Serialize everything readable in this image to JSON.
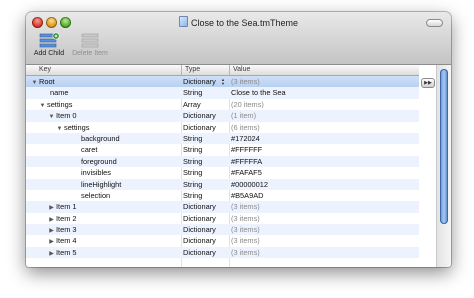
{
  "window": {
    "title": "Close to the Sea.tmTheme"
  },
  "toolbar": {
    "add_child_label": "Add Child",
    "delete_item_label": "Delete Item"
  },
  "table": {
    "headers": {
      "key": "Key",
      "type": "Type",
      "value": "Value"
    },
    "rows": [
      {
        "key": "Root",
        "type": "Dictionary",
        "value": "(3 items)"
      },
      {
        "key": "name",
        "type": "String",
        "value": "Close to the Sea"
      },
      {
        "key": "settings",
        "type": "Array",
        "value": "(20 items)"
      },
      {
        "key": "Item 0",
        "type": "Dictionary",
        "value": "(1 item)"
      },
      {
        "key": "settings",
        "type": "Dictionary",
        "value": "(6 items)"
      },
      {
        "key": "background",
        "type": "String",
        "value": "#172024"
      },
      {
        "key": "caret",
        "type": "String",
        "value": "#FFFFFF"
      },
      {
        "key": "foreground",
        "type": "String",
        "value": "#FFFFFA"
      },
      {
        "key": "invisibles",
        "type": "String",
        "value": "#FAFAF5"
      },
      {
        "key": "lineHighlight",
        "type": "String",
        "value": "#00000012"
      },
      {
        "key": "selection",
        "type": "String",
        "value": "#B5A9AD"
      },
      {
        "key": "Item 1",
        "type": "Dictionary",
        "value": "(3 items)"
      },
      {
        "key": "Item 2",
        "type": "Dictionary",
        "value": "(3 items)"
      },
      {
        "key": "Item 3",
        "type": "Dictionary",
        "value": "(3 items)"
      },
      {
        "key": "Item 4",
        "type": "Dictionary",
        "value": "(3 items)"
      },
      {
        "key": "Item 5",
        "type": "Dictionary",
        "value": "(3 items)"
      }
    ]
  },
  "colors": {
    "selection_row": "#c6daf6",
    "alternate_row": "#edf3fe",
    "scroll_thumb": "#6f9ad8"
  }
}
